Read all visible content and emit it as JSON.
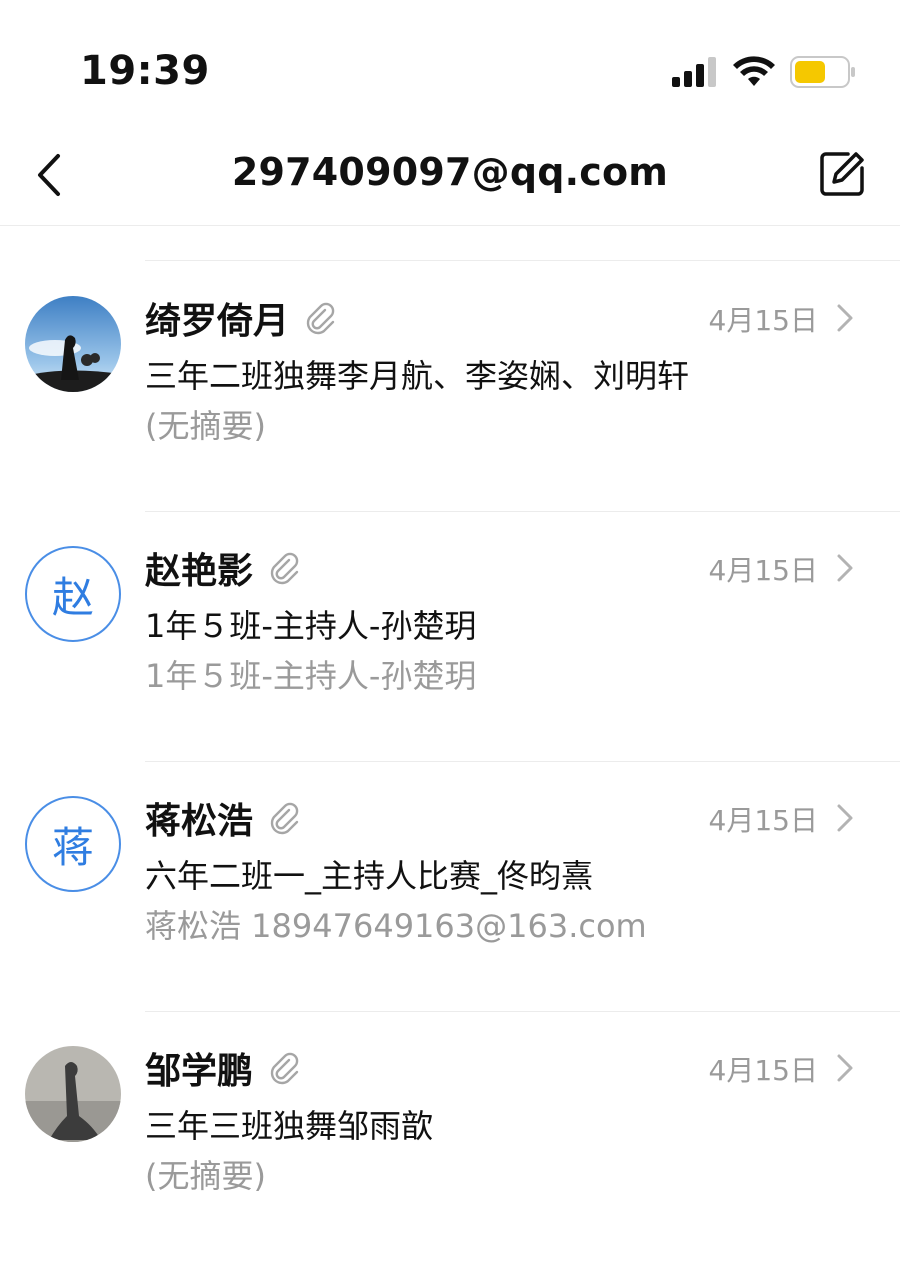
{
  "status_bar": {
    "time": "19:39",
    "icons": [
      "signal-icon",
      "wifi-icon",
      "battery-icon"
    ],
    "battery_color": "#f5c800"
  },
  "nav": {
    "title": "297409097@qq.com",
    "back_icon": "chevron-left-icon",
    "compose_icon": "compose-icon"
  },
  "colors": {
    "accent": "#2f7de1",
    "secondary_text": "#9a9a9a",
    "divider": "#ececec"
  },
  "mails": [
    {
      "sender": "绮罗倚月",
      "date": "4月15日",
      "subject": "三年二班独舞李月航、李姿娴、刘明轩",
      "summary": "(无摘要)",
      "avatar_type": "photo",
      "avatar_letter": "",
      "has_attachment": true
    },
    {
      "sender": "赵艳影",
      "date": "4月15日",
      "subject": "1年５班-主持人-孙楚玥",
      "summary": "1年５班-主持人-孙楚玥",
      "avatar_type": "letter",
      "avatar_letter": "赵",
      "has_attachment": true
    },
    {
      "sender": "蒋松浩",
      "date": "4月15日",
      "subject": "六年二班一_主持人比赛_佟昀熹",
      "summary": "蒋松浩  18947649163@163.com",
      "avatar_type": "letter",
      "avatar_letter": "蒋",
      "has_attachment": true
    },
    {
      "sender": "邹学鹏",
      "date": "4月15日",
      "subject": "三年三班独舞邹雨歆",
      "summary": "(无摘要)",
      "avatar_type": "photo",
      "avatar_letter": "",
      "has_attachment": true
    }
  ]
}
